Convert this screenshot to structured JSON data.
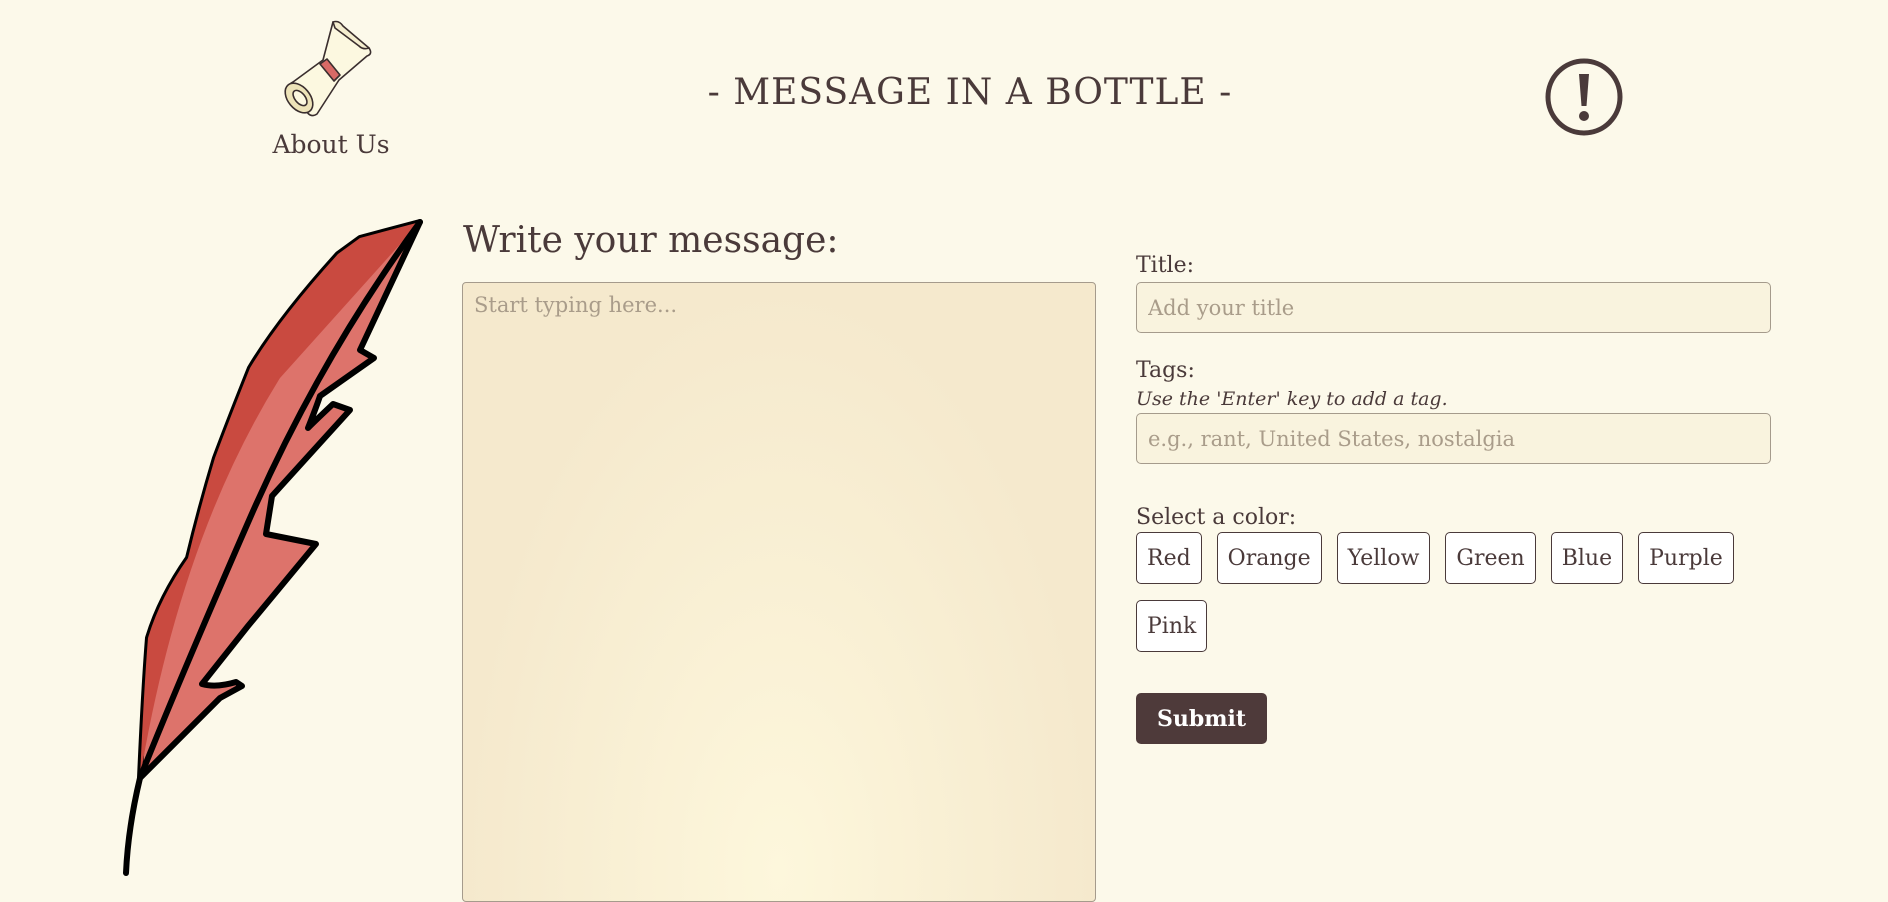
{
  "header": {
    "about_label": "About Us",
    "title": "- MESSAGE IN A BOTTLE -",
    "about_icon": "scroll-icon",
    "alert_icon": "exclamation-circle-icon"
  },
  "editor": {
    "heading": "Write your message:",
    "placeholder": "Start typing here..."
  },
  "form": {
    "title_label": "Title:",
    "title_placeholder": "Add your title",
    "tags_label": "Tags:",
    "tags_hint": "Use the 'Enter' key to add a tag.",
    "tags_placeholder": "e.g., rant, United States, nostalgia",
    "color_label": "Select a color:",
    "colors": [
      "Red",
      "Orange",
      "Yellow",
      "Green",
      "Blue",
      "Purple",
      "Pink"
    ],
    "submit_label": "Submit"
  },
  "decoration": {
    "quill_icon": "quill-feather-icon"
  },
  "theme": {
    "background": "#fcf9ea",
    "text": "#4a3a3a",
    "submit_bg": "#4e3a3a",
    "feather_red": "#d85b52"
  }
}
